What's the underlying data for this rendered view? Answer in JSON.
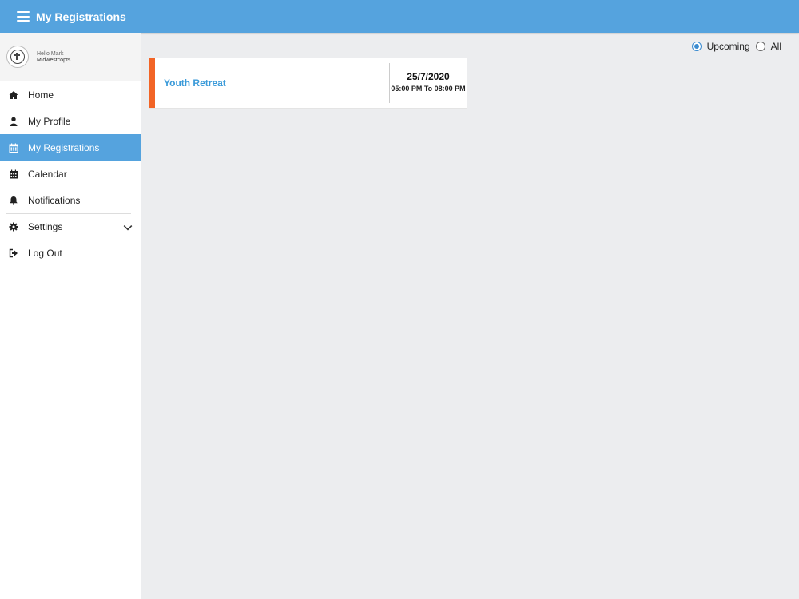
{
  "header": {
    "title": "My Registrations"
  },
  "profile": {
    "greeting": "Hello Mark",
    "org": "Midwestcopts"
  },
  "sidebar": {
    "items": [
      {
        "label": "Home",
        "icon": "home-icon"
      },
      {
        "label": "My Profile",
        "icon": "user-icon"
      },
      {
        "label": "My Registrations",
        "icon": "calendar-grid-icon",
        "active": true
      },
      {
        "label": "Calendar",
        "icon": "calendar-icon"
      },
      {
        "label": "Notifications",
        "icon": "bell-icon"
      },
      {
        "label": "Settings",
        "icon": "gear-icon"
      },
      {
        "label": "Log Out",
        "icon": "logout-icon"
      }
    ]
  },
  "filter": {
    "options": [
      "Upcoming",
      "All"
    ],
    "selected": "Upcoming"
  },
  "registrations": [
    {
      "title": "Youth Retreat",
      "date": "25/7/2020",
      "time": "05:00 PM To 08:00 PM"
    }
  ],
  "colors": {
    "accent": "#55a3de",
    "event_bar": "#f26426",
    "event_title": "#3a9ad9"
  }
}
